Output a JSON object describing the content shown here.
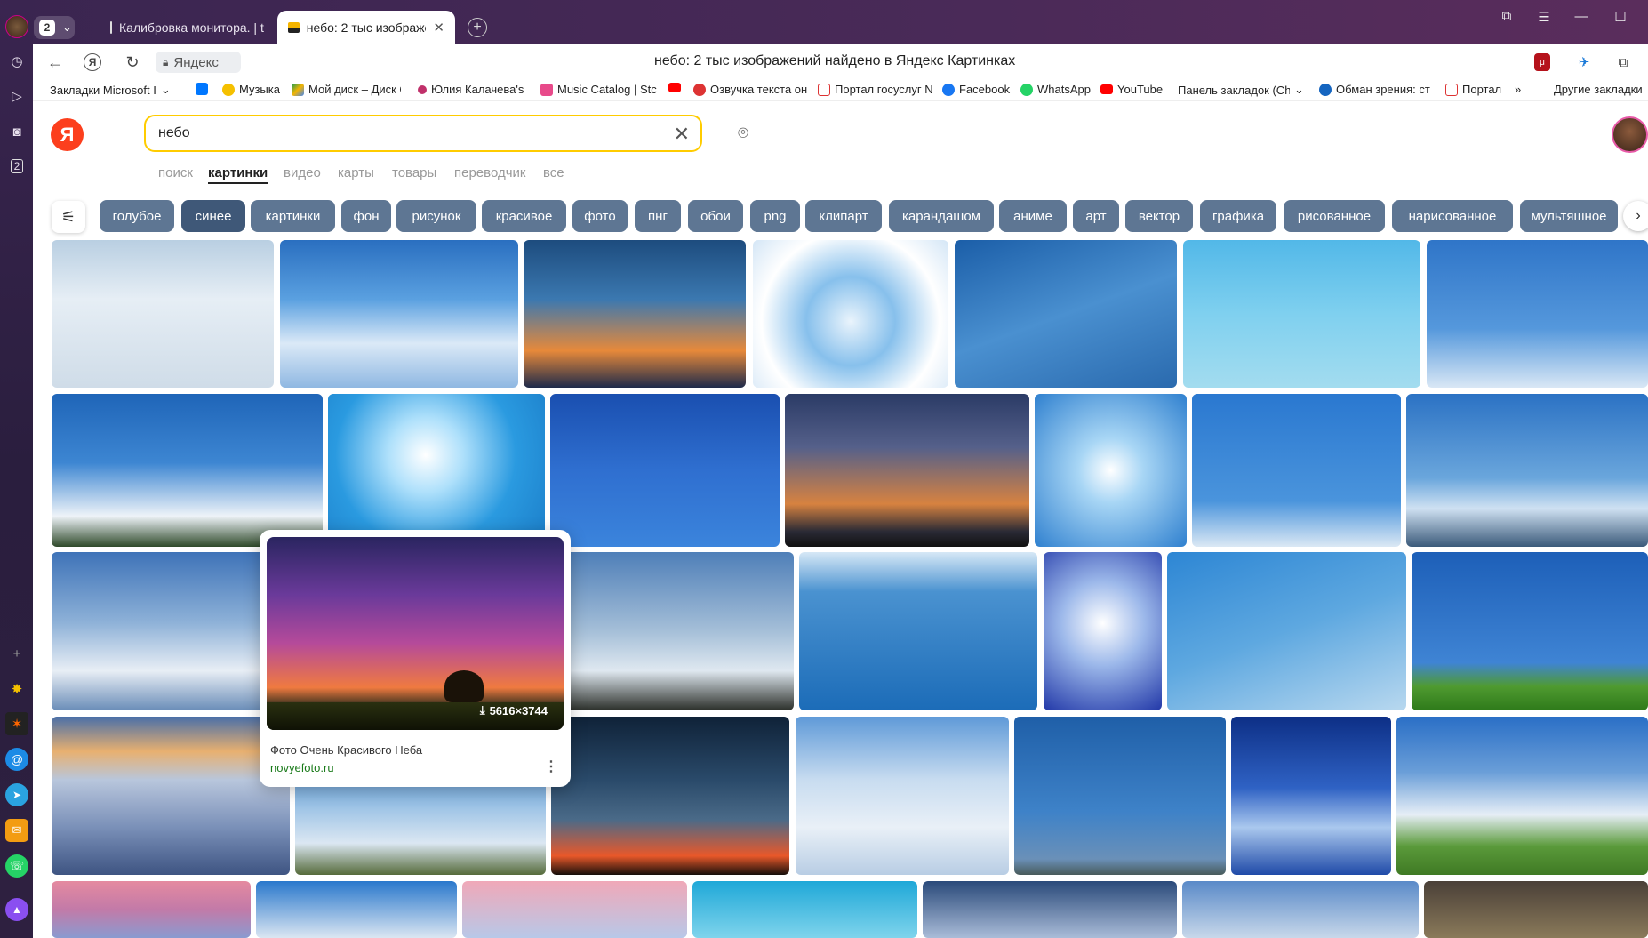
{
  "browser": {
    "tab_count": "2",
    "tabs": [
      {
        "label": "Калибровка монитора. | t"
      },
      {
        "label": "небо: 2 тыс изображен"
      }
    ],
    "url_label": "Яндекс",
    "page_title": "небо: 2 тыс изображений найдено в Яндекс Картинках",
    "sidebar_badge": "2",
    "bookmarks": [
      "Закладки Microsoft I",
      "Музыка",
      "Мой диск – Диск G",
      "Юлия Калачева's",
      "Music Catalog | Stc",
      "Озвучка текста он",
      "Портал госуслуг N",
      "Facebook",
      "WhatsApp",
      "YouTube",
      "Панель закладок (Ch",
      "Обман зрения: ст",
      "Портал",
      "Другие закладки"
    ]
  },
  "search": {
    "query": "небо",
    "logo": "Я"
  },
  "services": [
    "поиск",
    "картинки",
    "видео",
    "карты",
    "товары",
    "переводчик",
    "все"
  ],
  "chips": [
    "голубое",
    "синее",
    "картинки",
    "фон",
    "рисунок",
    "красивое",
    "фото",
    "пнг",
    "обои",
    "png",
    "клипарт",
    "карандашом",
    "аниме",
    "арт",
    "вектор",
    "графика",
    "рисованное",
    "нарисованное",
    "мультяшное"
  ],
  "hover_card": {
    "size": "5616×3744",
    "title": "Фото Очень Красивого Неба",
    "domain": "novyefoto.ru"
  },
  "colors": {
    "yandex_red": "#fc3f1d",
    "search_border": "#ffcc00",
    "chip_bg": "#5e7693"
  }
}
